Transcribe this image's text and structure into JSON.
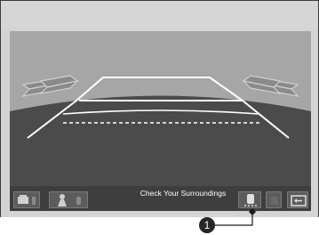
{
  "status": {
    "message": "Check Your Surroundings"
  },
  "toolbar": {
    "buttons": [
      {
        "name": "camera-view-button",
        "icon": "car-top-view-icon"
      },
      {
        "name": "guideline-view-button",
        "icon": "person-guide-icon"
      },
      {
        "name": "sensor-button",
        "icon": "car-sensor-icon"
      },
      {
        "name": "grid-button",
        "icon": "grid-icon"
      },
      {
        "name": "exit-button",
        "icon": "exit-icon"
      }
    ]
  },
  "callout": {
    "number": "1"
  },
  "colors": {
    "camera_bg": "#a6a6a6",
    "ground": "#4a4a4a",
    "guidelines": "#ffffff",
    "toolbar": "#3e3e3e"
  }
}
